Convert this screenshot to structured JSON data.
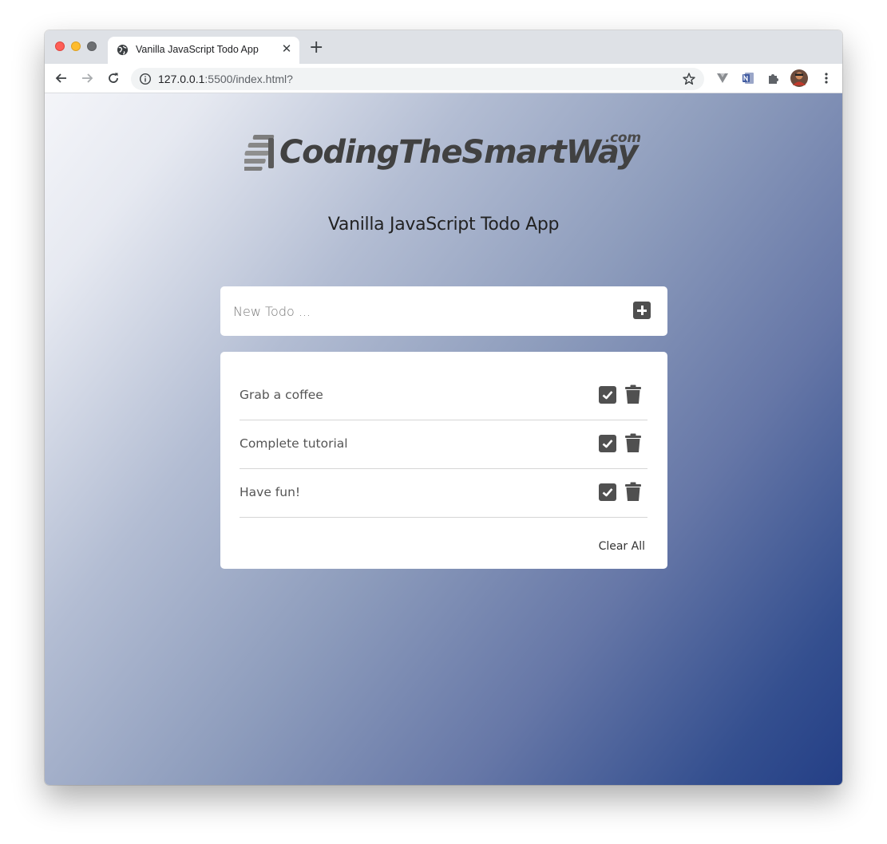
{
  "browser": {
    "tab_title": "Vanilla JavaScript Todo App",
    "tab_close": "✕",
    "new_tab": "+",
    "url_host": "127.0.0.1",
    "url_rest": ":5500/index.html?"
  },
  "page": {
    "logo_text": "CodingTheSmartWay",
    "logo_suffix": ".com",
    "app_title": "Vanilla JavaScript Todo App",
    "new_todo_placeholder": "New Todo ...",
    "new_todo_value": "",
    "todos": [
      {
        "text": "Grab a coffee"
      },
      {
        "text": "Complete tutorial"
      },
      {
        "text": "Have fun!"
      }
    ],
    "clear_all_label": "Clear All"
  },
  "colors": {
    "gradient_start": "#f4f5f9",
    "gradient_end": "#243f86",
    "icon_dark": "#505050"
  },
  "icons": [
    "globe-icon",
    "back-arrow-icon",
    "forward-arrow-icon",
    "reload-icon",
    "info-icon",
    "star-icon",
    "extension-icon",
    "onenote-icon",
    "puzzle-icon",
    "avatar",
    "menu-dots-icon",
    "plus-square-icon",
    "check-square-icon",
    "trash-icon"
  ]
}
